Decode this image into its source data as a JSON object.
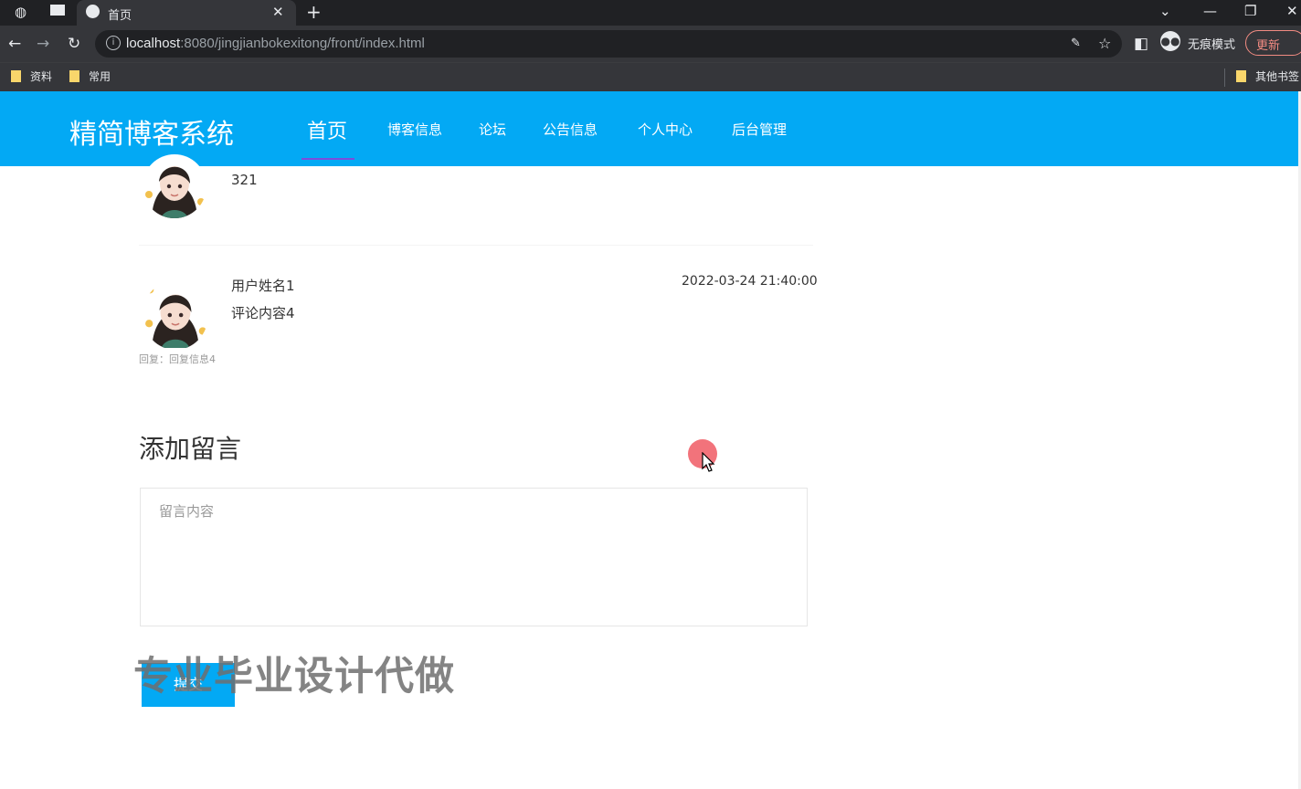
{
  "browser": {
    "tab_title": "首页",
    "url_host": "localhost",
    "url_path": ":8080/jingjianbokexitong/front/index.html",
    "incognito_label": "无痕模式",
    "update_label": "更新",
    "bookmarks": [
      "资料",
      "常用"
    ],
    "other_bookmarks": "其他书签"
  },
  "site": {
    "logo": "精简博客系统",
    "nav": [
      "首页",
      "博客信息",
      "论坛",
      "公告信息",
      "个人中心",
      "后台管理"
    ],
    "active_nav": "首页"
  },
  "comments": [
    {
      "content": "321"
    },
    {
      "user": "用户姓名1",
      "content": "评论内容4",
      "time": "2022-03-24 21:40:00",
      "reply": "回复：回复信息4"
    }
  ],
  "add_message": {
    "title": "添加留言",
    "placeholder": "留言内容",
    "submit_label": "提交"
  },
  "watermark": "专业毕业设计代做",
  "colors": {
    "brand": "#03a9f4",
    "click_indicator": "#f05a64"
  }
}
